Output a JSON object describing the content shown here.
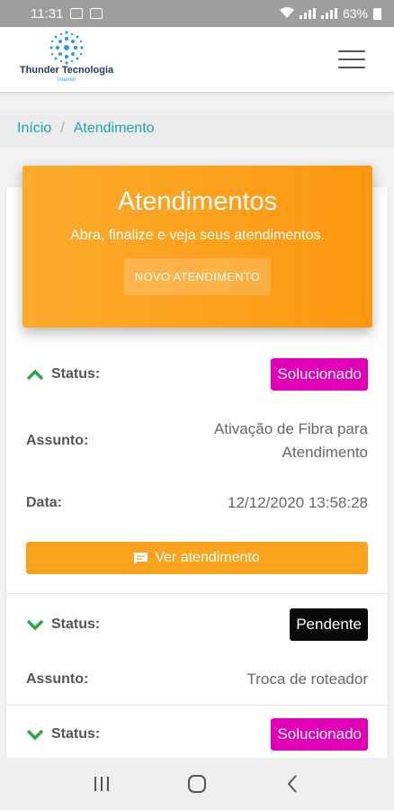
{
  "statusbar": {
    "time": "11:31",
    "battery": "63%"
  },
  "header": {
    "brand": "Thunder Tecnologia",
    "brand_sub": "Internet"
  },
  "breadcrumb": {
    "home": "Início",
    "separator": "/",
    "current": "Atendimento"
  },
  "hero": {
    "title": "Atendimentos",
    "subtitle": "Abra, finalize e veja seus atendimentos.",
    "button": "NOVO ATENDIMENTO"
  },
  "labels": {
    "status": "Status:",
    "assunto": "Assunto:",
    "data": "Data:",
    "ver": "Ver atendimento"
  },
  "tickets": [
    {
      "expanded": true,
      "status": "Solucionado",
      "status_color": "#e100b8",
      "assunto_line1": "Ativação de Fibra para",
      "assunto_line2": "Atendimento",
      "data": "12/12/2020 13:58:28"
    },
    {
      "expanded": false,
      "status": "Pendente",
      "status_color": "#0a0a0a",
      "assunto": "Troca de roteador"
    },
    {
      "expanded": false,
      "status": "Solucionado",
      "status_color": "#e100b8"
    }
  ],
  "colors": {
    "accent": "#fba31c",
    "link": "#17a2b8",
    "chevron": "#28a745"
  },
  "icons": [
    "menu-icon",
    "chevron-up-icon",
    "chevron-down-icon",
    "chat-icon",
    "recents-icon",
    "home-icon",
    "back-icon"
  ]
}
